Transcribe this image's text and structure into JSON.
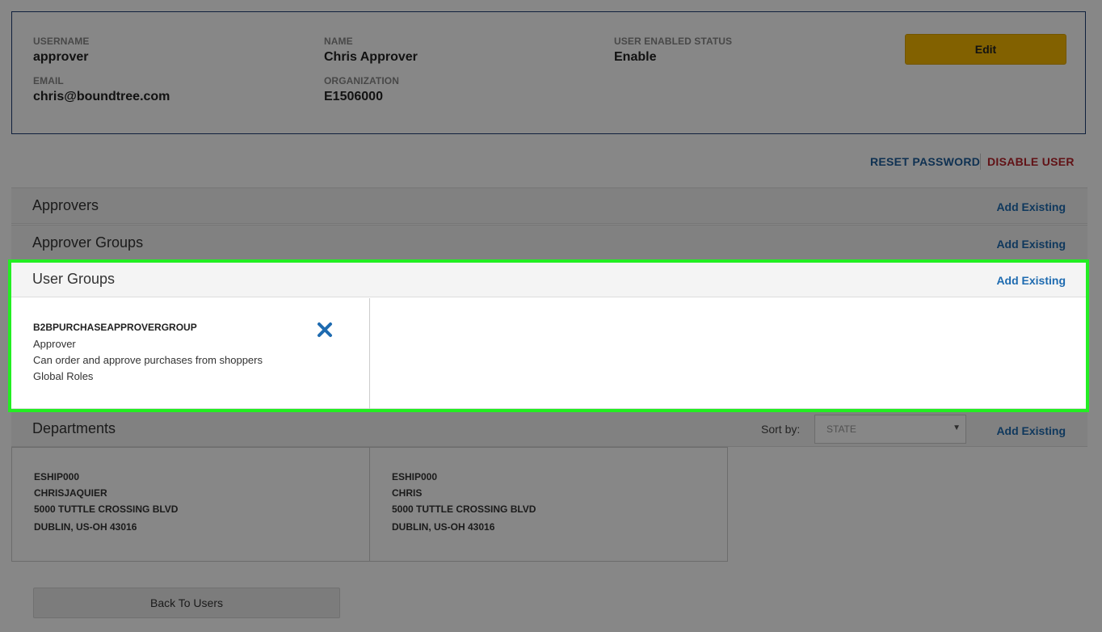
{
  "user": {
    "username_label": "USERNAME",
    "username": "approver",
    "name_label": "NAME",
    "name": "Chris Approver",
    "status_label": "USER ENABLED STATUS",
    "status": "Enable",
    "email_label": "EMAIL",
    "email": "chris@boundtree.com",
    "org_label": "ORGANIZATION",
    "organization": "E1506000",
    "edit_label": "Edit"
  },
  "actions": {
    "reset_password": "RESET PASSWORD",
    "disable_user": "DISABLE USER"
  },
  "sections": {
    "approvers": {
      "title": "Approvers",
      "add_label": "Add Existing"
    },
    "approver_groups": {
      "title": "Approver Groups",
      "add_label": "Add Existing"
    },
    "user_groups": {
      "title": "User Groups",
      "add_label": "Add Existing"
    },
    "departments": {
      "title": "Departments",
      "add_label": "Add Existing"
    }
  },
  "user_groups": [
    {
      "name": "B2BPURCHASEAPPROVERGROUP",
      "role": "Approver",
      "description": "Can order and approve purchases from shoppers",
      "scope": "Global Roles"
    }
  ],
  "sort": {
    "label": "Sort by:",
    "selected": "STATE"
  },
  "departments": [
    {
      "code": "ESHIP000",
      "name": "CHRISJAQUIER",
      "street": "5000 TUTTLE CROSSING BLVD",
      "city": "DUBLIN, US-OH 43016"
    },
    {
      "code": "ESHIP000",
      "name": "CHRIS",
      "street": "5000 TUTTLE CROSSING BLVD",
      "city": "DUBLIN, US-OH 43016"
    }
  ],
  "back_label": "Back To Users",
  "colors": {
    "primary_button": "#f5b700",
    "link_blue": "#1e6bb0",
    "danger_red": "#b8232b",
    "highlight": "#22ee22"
  }
}
